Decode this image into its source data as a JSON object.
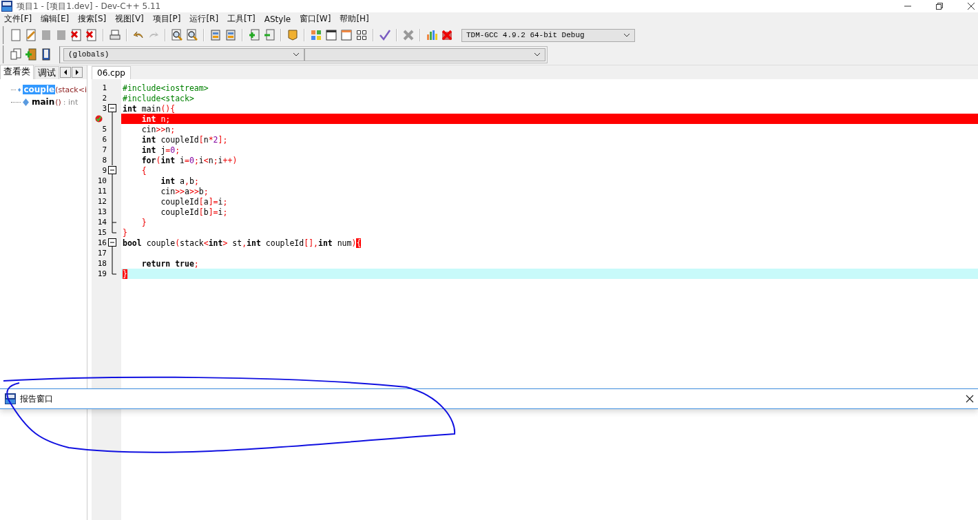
{
  "window": {
    "title": "项目1 - [项目1.dev] - Dev-C++ 5.11"
  },
  "menu": [
    {
      "label": "文件[F]"
    },
    {
      "label": "编辑[E]"
    },
    {
      "label": "搜索[S]"
    },
    {
      "label": "视图[V]"
    },
    {
      "label": "项目[P]"
    },
    {
      "label": "运行[R]"
    },
    {
      "label": "工具[T]"
    },
    {
      "label": "AStyle"
    },
    {
      "label": "窗口[W]"
    },
    {
      "label": "帮助[H]"
    }
  ],
  "compiler_select": {
    "value": "TDM-GCC 4.9.2 64-bit Debug"
  },
  "scope_select": {
    "value": "(globals)"
  },
  "left_tabs": [
    {
      "label": "查看类",
      "selected": true
    },
    {
      "label": "调试",
      "selected": false
    }
  ],
  "class_tree": [
    {
      "name": "couple",
      "signature": "(stack<i",
      "selected": true
    },
    {
      "name": "main",
      "signature": "()",
      "type": ": int",
      "selected": false
    }
  ],
  "editor_tabs": [
    {
      "label": "06.cpp",
      "selected": true
    }
  ],
  "code_lines": [
    {
      "number": "1",
      "kind": "plain",
      "current": false,
      "breakpoint": false,
      "tokens": [
        {
          "t": "#include<iostream>",
          "kind": "preprocessor"
        }
      ]
    },
    {
      "number": "2",
      "kind": "plain",
      "current": false,
      "breakpoint": false,
      "tokens": [
        {
          "t": "#include<stack>",
          "kind": "preprocessor"
        }
      ]
    },
    {
      "number": "3",
      "kind": "foldstart",
      "current": false,
      "breakpoint": false,
      "tokens": [
        {
          "t": "int",
          "kind": "keyword"
        },
        {
          "t": " main",
          "kind": "identifier"
        },
        {
          "t": "(){",
          "kind": "symbol"
        }
      ]
    },
    {
      "kind": "foldline",
      "current": false,
      "breakpoint": true,
      "tokens": [
        {
          "t": "    int",
          "kind": "keyword"
        },
        {
          "t": " n",
          "kind": "identifier"
        },
        {
          "t": ";",
          "kind": "symbol"
        }
      ]
    },
    {
      "number": "5",
      "kind": "foldline",
      "current": false,
      "breakpoint": false,
      "tokens": [
        {
          "t": "    cin",
          "kind": "identifier"
        },
        {
          "t": ">>",
          "kind": "symbol"
        },
        {
          "t": "n",
          "kind": "identifier"
        },
        {
          "t": ";",
          "kind": "symbol"
        }
      ]
    },
    {
      "number": "6",
      "kind": "foldline",
      "current": false,
      "breakpoint": false,
      "tokens": [
        {
          "t": "    int",
          "kind": "keyword"
        },
        {
          "t": " coupleId",
          "kind": "identifier"
        },
        {
          "t": "[",
          "kind": "symbol"
        },
        {
          "t": "n",
          "kind": "identifier"
        },
        {
          "t": "*",
          "kind": "symbol"
        },
        {
          "t": "2",
          "kind": "number"
        },
        {
          "t": "];",
          "kind": "symbol"
        }
      ]
    },
    {
      "number": "7",
      "kind": "foldline",
      "current": false,
      "breakpoint": false,
      "tokens": [
        {
          "t": "    int",
          "kind": "keyword"
        },
        {
          "t": " j",
          "kind": "identifier"
        },
        {
          "t": "=",
          "kind": "symbol"
        },
        {
          "t": "0",
          "kind": "number"
        },
        {
          "t": ";",
          "kind": "symbol"
        }
      ]
    },
    {
      "number": "8",
      "kind": "foldline",
      "current": false,
      "breakpoint": false,
      "tokens": [
        {
          "t": "    for",
          "kind": "keyword"
        },
        {
          "t": "(",
          "kind": "symbol"
        },
        {
          "t": "int",
          "kind": "keyword"
        },
        {
          "t": " i",
          "kind": "identifier"
        },
        {
          "t": "=",
          "kind": "symbol"
        },
        {
          "t": "0",
          "kind": "number"
        },
        {
          "t": ";",
          "kind": "symbol"
        },
        {
          "t": "i",
          "kind": "identifier"
        },
        {
          "t": "<",
          "kind": "symbol"
        },
        {
          "t": "n",
          "kind": "identifier"
        },
        {
          "t": ";",
          "kind": "symbol"
        },
        {
          "t": "i",
          "kind": "identifier"
        },
        {
          "t": "++)",
          "kind": "symbol"
        }
      ]
    },
    {
      "number": "9",
      "kind": "foldstart",
      "current": false,
      "breakpoint": false,
      "tokens": [
        {
          "t": "    {",
          "kind": "symbol"
        }
      ]
    },
    {
      "number": "10",
      "kind": "foldline",
      "current": false,
      "breakpoint": false,
      "tokens": [
        {
          "t": "        int",
          "kind": "keyword"
        },
        {
          "t": " a",
          "kind": "identifier"
        },
        {
          "t": ",",
          "kind": "symbol"
        },
        {
          "t": "b",
          "kind": "identifier"
        },
        {
          "t": ";",
          "kind": "symbol"
        }
      ]
    },
    {
      "number": "11",
      "kind": "foldline",
      "current": false,
      "breakpoint": false,
      "tokens": [
        {
          "t": "        cin",
          "kind": "identifier"
        },
        {
          "t": ">>",
          "kind": "symbol"
        },
        {
          "t": "a",
          "kind": "identifier"
        },
        {
          "t": ">>",
          "kind": "symbol"
        },
        {
          "t": "b",
          "kind": "identifier"
        },
        {
          "t": ";",
          "kind": "symbol"
        }
      ]
    },
    {
      "number": "12",
      "kind": "foldline",
      "current": false,
      "breakpoint": false,
      "tokens": [
        {
          "t": "        coupleId",
          "kind": "identifier"
        },
        {
          "t": "[",
          "kind": "symbol"
        },
        {
          "t": "a",
          "kind": "identifier"
        },
        {
          "t": "]=",
          "kind": "symbol"
        },
        {
          "t": "i",
          "kind": "identifier"
        },
        {
          "t": ";",
          "kind": "symbol"
        }
      ]
    },
    {
      "number": "13",
      "kind": "foldline",
      "current": false,
      "breakpoint": false,
      "tokens": [
        {
          "t": "        coupleId",
          "kind": "identifier"
        },
        {
          "t": "[",
          "kind": "symbol"
        },
        {
          "t": "b",
          "kind": "identifier"
        },
        {
          "t": "]=",
          "kind": "symbol"
        },
        {
          "t": "i",
          "kind": "identifier"
        },
        {
          "t": ";",
          "kind": "symbol"
        }
      ]
    },
    {
      "number": "14",
      "kind": "foldbranch",
      "current": false,
      "breakpoint": false,
      "tokens": [
        {
          "t": "    }",
          "kind": "symbol"
        }
      ]
    },
    {
      "number": "15",
      "kind": "foldend",
      "current": false,
      "breakpoint": false,
      "tokens": [
        {
          "t": "}",
          "kind": "symbol"
        }
      ]
    },
    {
      "number": "16",
      "kind": "foldstart",
      "current": false,
      "breakpoint": false,
      "tokens": [
        {
          "t": "bool",
          "kind": "keyword"
        },
        {
          "t": " couple",
          "kind": "identifier"
        },
        {
          "t": "(",
          "kind": "symbol"
        },
        {
          "t": "stack",
          "kind": "identifier"
        },
        {
          "t": "<",
          "kind": "symbol"
        },
        {
          "t": "int",
          "kind": "keyword"
        },
        {
          "t": ">",
          "kind": "symbol"
        },
        {
          "t": " st",
          "kind": "identifier"
        },
        {
          "t": ",",
          "kind": "symbol"
        },
        {
          "t": "int",
          "kind": "keyword"
        },
        {
          "t": " coupleId",
          "kind": "identifier"
        },
        {
          "t": "[],",
          "kind": "symbol"
        },
        {
          "t": "int",
          "kind": "keyword"
        },
        {
          "t": " num",
          "kind": "identifier"
        },
        {
          "t": ")",
          "kind": "symbol"
        },
        {
          "t": "{",
          "kind": "bracematch"
        }
      ]
    },
    {
      "number": "17",
      "kind": "foldline",
      "current": false,
      "breakpoint": false
    },
    {
      "number": "18",
      "kind": "foldline",
      "current": false,
      "breakpoint": false,
      "tokens": [
        {
          "t": "    return true",
          "kind": "keyword"
        },
        {
          "t": ";",
          "kind": "symbol"
        }
      ]
    },
    {
      "number": "19",
      "kind": "foldend",
      "current": true,
      "breakpoint": false,
      "tokens": [
        {
          "t": "}",
          "kind": "bracematch"
        }
      ]
    }
  ],
  "report_panel": {
    "title": "报告窗口"
  }
}
